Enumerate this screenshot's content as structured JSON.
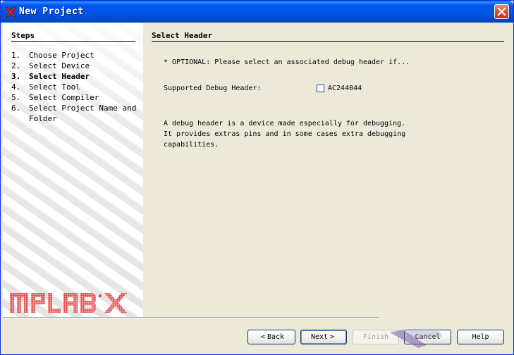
{
  "window": {
    "title": "New Project"
  },
  "steps": {
    "title": "Steps",
    "items": [
      {
        "num": "1.",
        "label": "Choose Project",
        "current": false
      },
      {
        "num": "2.",
        "label": "Select Device",
        "current": false
      },
      {
        "num": "3.",
        "label": "Select Header",
        "current": true
      },
      {
        "num": "4.",
        "label": "Select Tool",
        "current": false
      },
      {
        "num": "5.",
        "label": "Select Compiler",
        "current": false
      },
      {
        "num": "6.",
        "label": "Select Project Name and Folder",
        "current": false
      }
    ]
  },
  "logo": {
    "text": "MPLAB X"
  },
  "content": {
    "title": "Select Header",
    "optional_text": "* OPTIONAL: Please select an associated debug header if...",
    "debug_header_label": "Supported Debug Header:",
    "debug_header_option": "AC244044",
    "debug_header_checked": false,
    "description": [
      "A debug header is a device made especially for debugging.",
      "It provides extras pins and in some cases extra debugging",
      "capabilities."
    ]
  },
  "buttons": {
    "back": {
      "label": "Back",
      "arrow": "<"
    },
    "next": {
      "label": "Next",
      "arrow": ">"
    },
    "finish": {
      "label": "Finish"
    },
    "cancel": {
      "label": "Cancel"
    },
    "help": {
      "label": "Help"
    }
  },
  "colors": {
    "titlebar": "#0053E1",
    "dialog_bg": "#ECE9D8",
    "logo_red": "#E23A3A"
  }
}
